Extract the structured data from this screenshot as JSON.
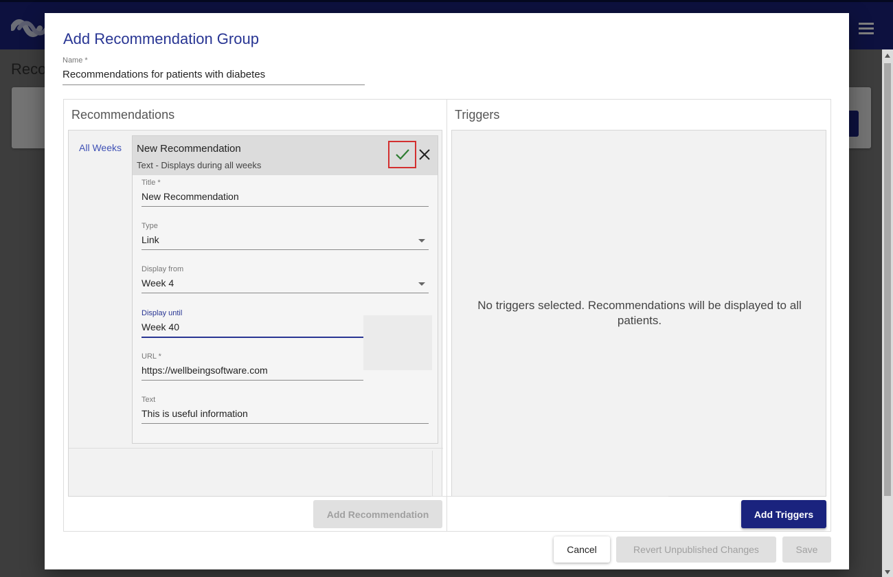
{
  "background": {
    "page_title_partial": "Reco",
    "logo_icon": "wave-logo-icon",
    "menu_icon": "hamburger-menu-icon"
  },
  "dialog": {
    "title": "Add Recommendation Group",
    "name_field": {
      "label": "Name *",
      "value": "Recommendations for patients with diabetes"
    },
    "recommendations": {
      "section_title": "Recommendations",
      "week_link": "All Weeks",
      "editor": {
        "title": "New Recommendation",
        "subtitle": "Text - Displays during all weeks",
        "fields": {
          "title": {
            "label": "Title *",
            "value": "New Recommendation"
          },
          "type": {
            "label": "Type",
            "value": "Link"
          },
          "display_from": {
            "label": "Display from",
            "value": "Week 4"
          },
          "display_until": {
            "label": "Display until",
            "value": "Week 40"
          },
          "url": {
            "label": "URL *",
            "value": "https://wellbeingsoftware.com"
          },
          "text": {
            "label": "Text",
            "value": "This is useful information"
          }
        }
      },
      "add_button": "Add Recommendation"
    },
    "triggers": {
      "section_title": "Triggers",
      "empty_message": "No triggers selected. Recommendations will be displayed to all patients.",
      "add_button": "Add Triggers"
    },
    "footer": {
      "cancel": "Cancel",
      "revert": "Revert Unpublished Changes",
      "save": "Save"
    }
  },
  "colors": {
    "primary": "#1a237e",
    "accent_text": "#283593",
    "confirm_check": "#2e7d32",
    "highlight_border": "#d32f2f"
  }
}
